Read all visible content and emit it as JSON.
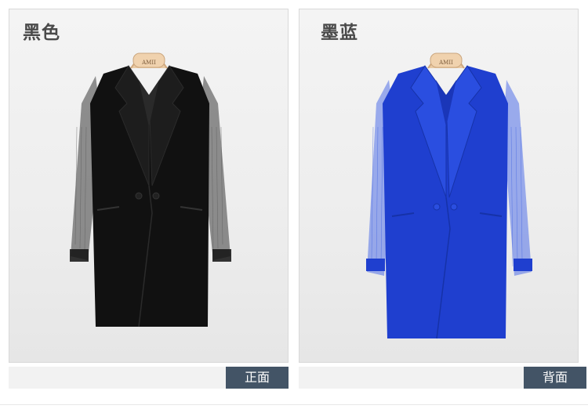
{
  "panels": [
    {
      "color_name": "黑色",
      "coat_color": "#111111",
      "coat_shade": "#2b2b2b",
      "view": "front"
    },
    {
      "color_name": "墨蓝",
      "coat_color": "#1f3fcf",
      "coat_shade": "#2f55e6",
      "view": "back"
    }
  ],
  "hanger_label": "AMII",
  "tags": {
    "front": "正面",
    "back": "背面"
  },
  "colors": {
    "tag_bg": "#435466",
    "title": "#4a4a4a"
  }
}
